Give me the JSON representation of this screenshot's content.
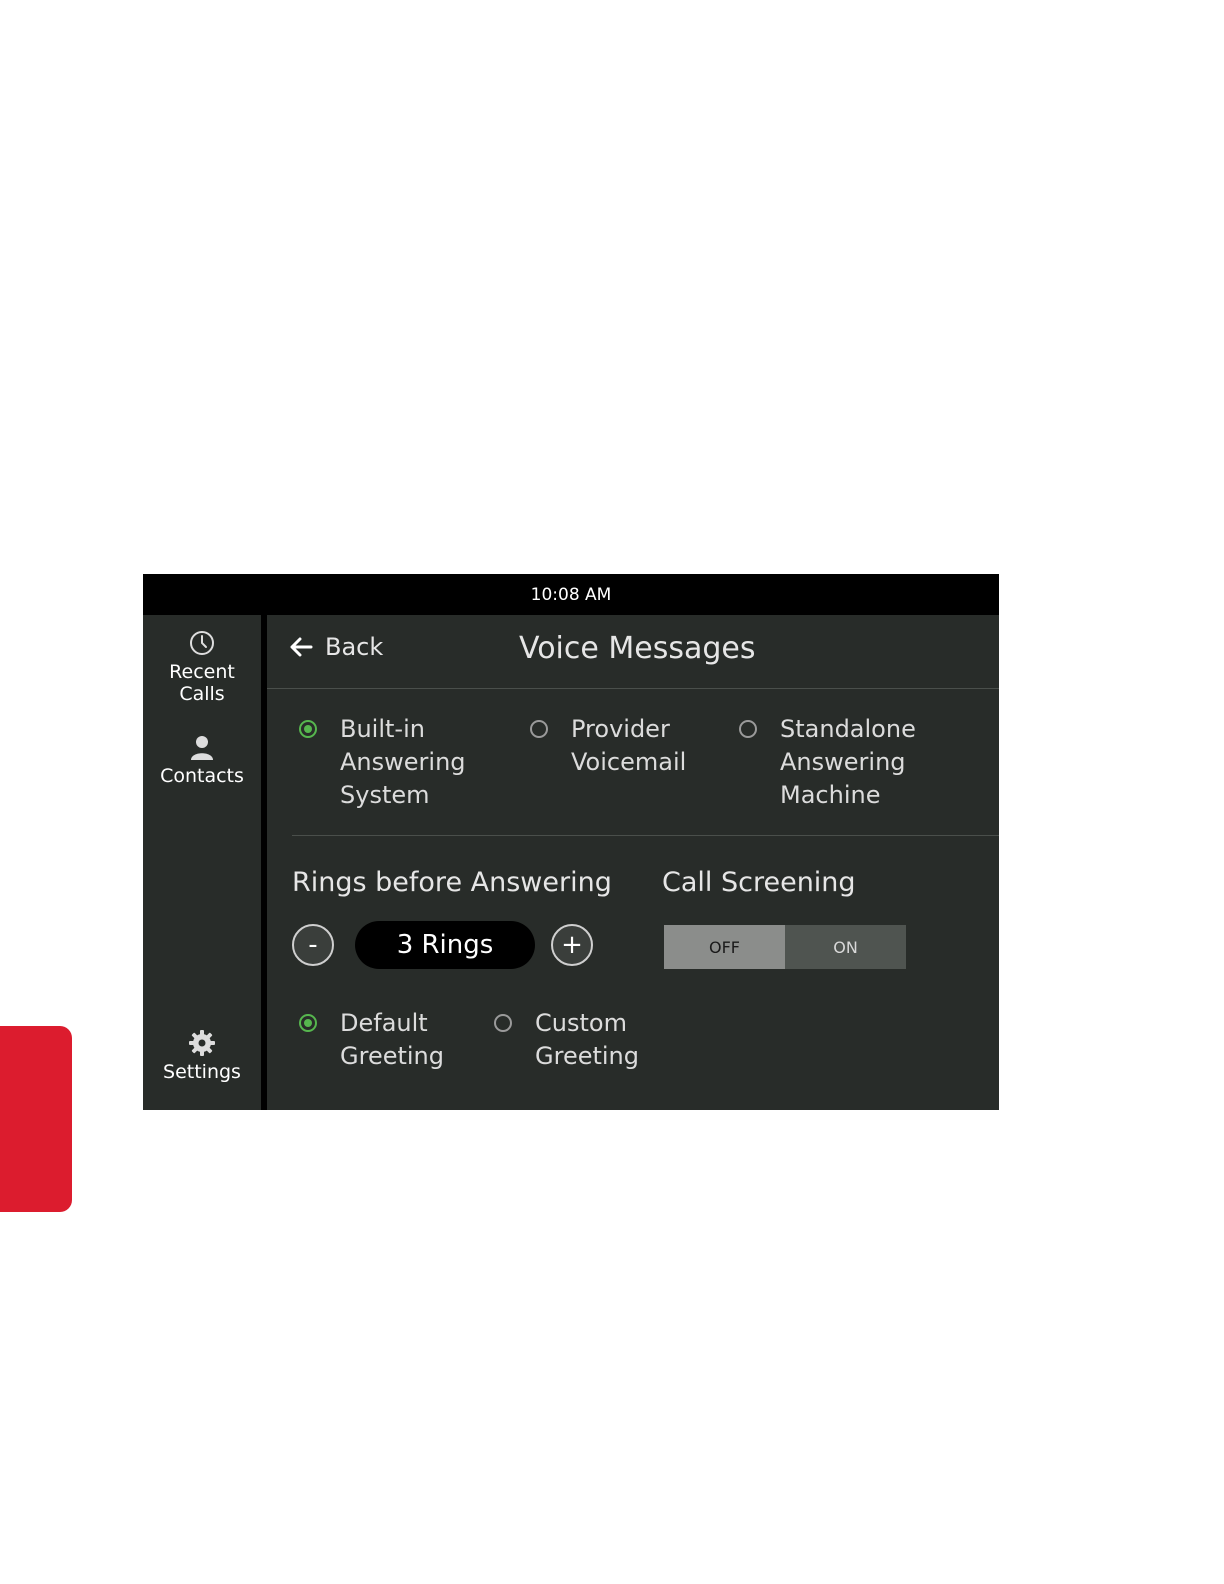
{
  "status_bar": {
    "time": "10:08  AM"
  },
  "sidebar": {
    "items": [
      {
        "label_line1": "Recent",
        "label_line2": "Calls",
        "icon": "clock-icon"
      },
      {
        "label": "Contacts",
        "icon": "person-icon"
      },
      {
        "label": "Settings",
        "icon": "gear-icon"
      }
    ]
  },
  "header": {
    "back_label": "Back",
    "title": "Voice Messages"
  },
  "answer_modes": [
    {
      "lines": [
        "Built-in",
        "Answering",
        "System"
      ],
      "selected": true
    },
    {
      "lines": [
        "Provider",
        "Voicemail"
      ],
      "selected": false
    },
    {
      "lines": [
        "Standalone",
        "Answering",
        "Machine"
      ],
      "selected": false
    }
  ],
  "rings": {
    "label": "Rings before Answering",
    "value": "3 Rings",
    "minus": "-",
    "plus": "+"
  },
  "call_screening": {
    "label": "Call Screening",
    "off": "OFF",
    "on": "ON",
    "state": "OFF"
  },
  "greetings": [
    {
      "lines": [
        "Default",
        "Greeting"
      ],
      "selected": true
    },
    {
      "lines": [
        "Custom",
        "Greeting"
      ],
      "selected": false
    }
  ],
  "colors": {
    "accent": "#56b64e",
    "brand_red": "#dc1c2e",
    "panel": "#282c29"
  }
}
